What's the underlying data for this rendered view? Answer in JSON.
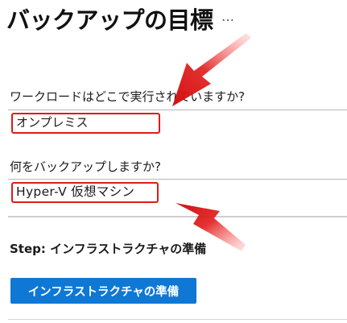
{
  "title": "バックアップの目標",
  "more_icon": "…",
  "workload": {
    "question": "ワークロードはどこで実行されていますか?",
    "value": "オンプレミス"
  },
  "backup_target": {
    "question": "何をバックアップしますか?",
    "value": "Hyper-V 仮想マシン"
  },
  "step": {
    "heading": "Step: インフラストラクチャの準備",
    "button_label": "インフラストラクチャの準備"
  },
  "annotations": {
    "arrow_color": "#e01a1a",
    "highlight_color": "#e01a1a"
  },
  "colors": {
    "button_bg": "#0f78d4",
    "button_text": "#ffffff"
  }
}
